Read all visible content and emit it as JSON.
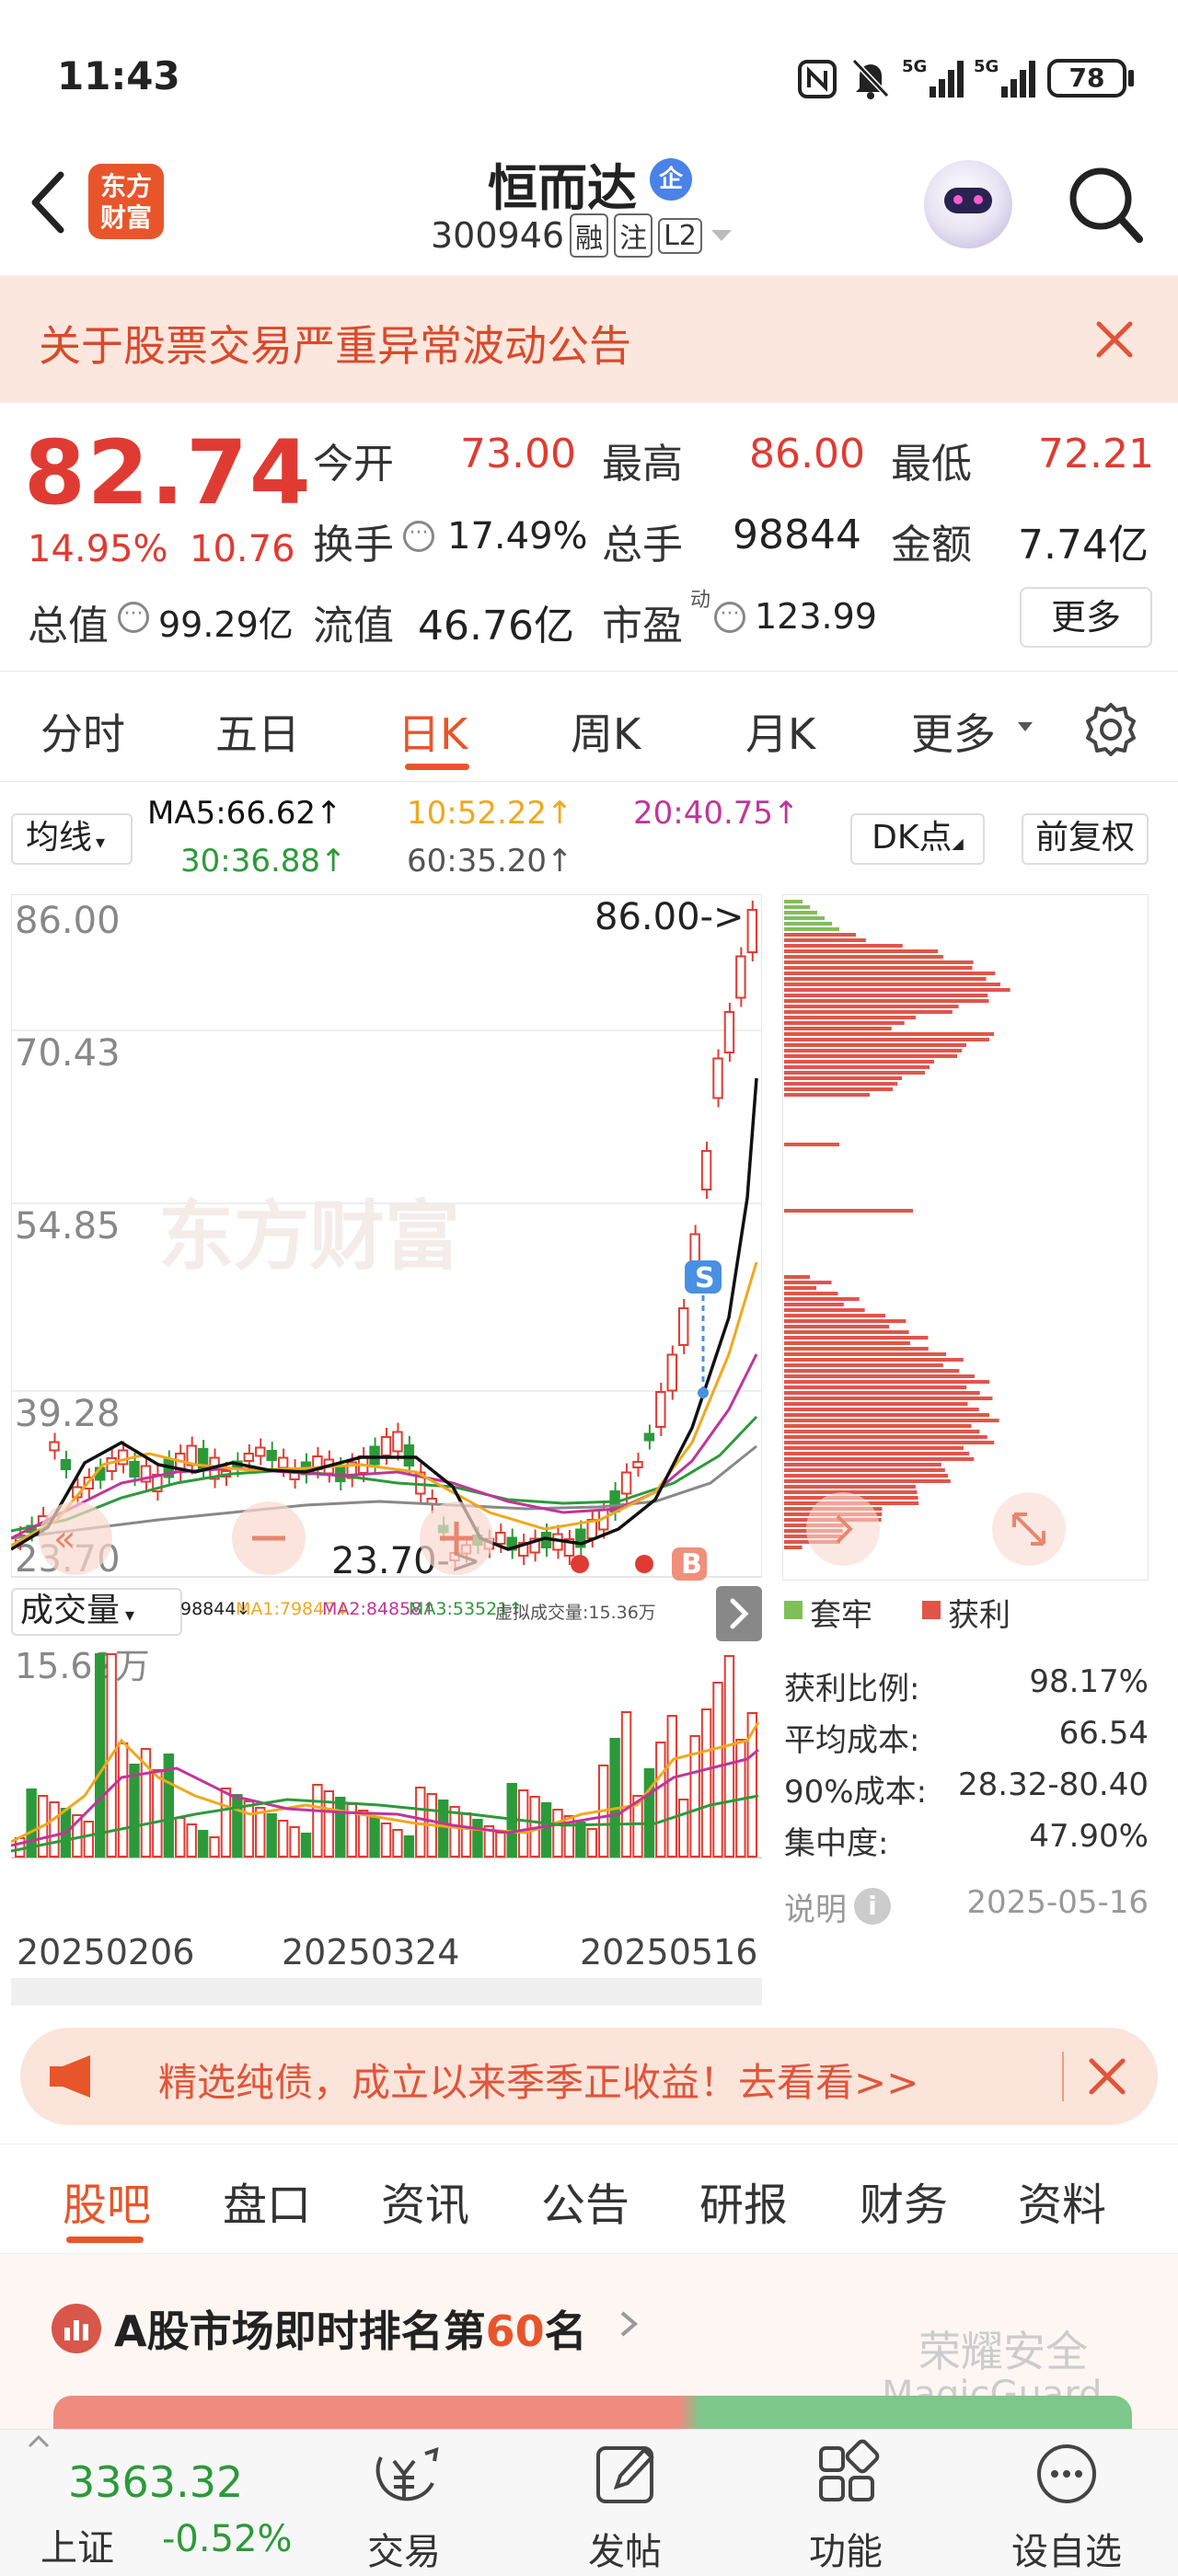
{
  "status_bar": {
    "time": "11:43",
    "battery": "78",
    "signal1": "5G",
    "signal2": "5G"
  },
  "header": {
    "app_logo_text_line1": "东方",
    "app_logo_text_line2": "财富",
    "stock_name": "恒而达",
    "company_badge": "企",
    "stock_code": "300946",
    "tags": [
      "融",
      "注",
      "L2"
    ]
  },
  "notice": {
    "text": "关于股票交易严重异常波动公告"
  },
  "quote": {
    "price": "82.74",
    "change_pct": "14.95%",
    "change_amt": "10.76",
    "open_label": "今开",
    "open": "73.00",
    "high_label": "最高",
    "high": "86.00",
    "low_label": "最低",
    "low": "72.21",
    "turnover_label": "换手",
    "turnover": "17.49%",
    "volume_label": "总手",
    "volume": "98844",
    "amount_label": "金额",
    "amount": "7.74亿",
    "mktcap_label": "总值",
    "mktcap": "99.29亿",
    "float_label": "流值",
    "float": "46.76亿",
    "pe_label": "市盈",
    "pe_sup": "动",
    "pe": "123.99",
    "more_button": "更多"
  },
  "chart_tabs": {
    "tabs": [
      "分时",
      "五日",
      "日K",
      "周K",
      "月K",
      "更多"
    ],
    "active": "日K"
  },
  "ma_bar": {
    "ma_select": "均线",
    "ma5": "MA5:66.62↑",
    "ma10": "10:52.22↑",
    "ma20": "20:40.75↑",
    "ma30": "30:36.88↑",
    "ma60": "60:35.20↑",
    "dk_button": "DK点",
    "adjust_button": "前复权"
  },
  "kline": {
    "y_labels": [
      "86.00",
      "70.43",
      "54.85",
      "39.28",
      "23.70"
    ],
    "high_marker": "86.00->",
    "low_marker": "23.70->",
    "watermark": "东方财富",
    "signal_s": "S",
    "signal_b": "B"
  },
  "volume": {
    "select": "成交量",
    "legend_total": "98844↓",
    "legend_ma1": "MA1:79847↓",
    "legend_ma2": "MA2:84858↑",
    "legend_ma3": "MA3:53521↑",
    "legend_virtual": "虚拟成交量:15.36万",
    "max_label": "15.62万",
    "dates": [
      "20250206",
      "20250324",
      "20250516"
    ]
  },
  "chip": {
    "legend_trapped": "套牢",
    "legend_profit": "获利",
    "rows": [
      {
        "label": "获利比例:",
        "value": "98.17%"
      },
      {
        "label": "平均成本:",
        "value": "66.54"
      },
      {
        "label": "90%成本:",
        "value": "28.32-80.40"
      },
      {
        "label": "集中度:",
        "value": "47.90%"
      }
    ],
    "explain": "说明",
    "date": "2025-05-16"
  },
  "ad": {
    "text": "精选纯债，成立以来季季正收益！去看看>>"
  },
  "bottom_tabs": {
    "tabs": [
      "股吧",
      "盘口",
      "资讯",
      "公告",
      "研报",
      "财务",
      "资料"
    ],
    "active": "股吧"
  },
  "rank": {
    "prefix": "A股市场即时排名第",
    "number": "60",
    "suffix": "名",
    "watermark1": "荣耀安全",
    "watermark2": "MagicGuard"
  },
  "bottom_nav": {
    "index_value": "3363.32",
    "index_name": "上证",
    "index_change": "-0.52%",
    "items": [
      "交易",
      "发帖",
      "功能",
      "设自选"
    ]
  },
  "colors": {
    "up": "#e03b32",
    "down": "#2c9a3a",
    "accent": "#e8552a",
    "ma5": "#111111",
    "ma10": "#f0a81c",
    "ma20": "#c0359a",
    "ma30": "#2c9a3a",
    "ma60": "#888888"
  }
}
